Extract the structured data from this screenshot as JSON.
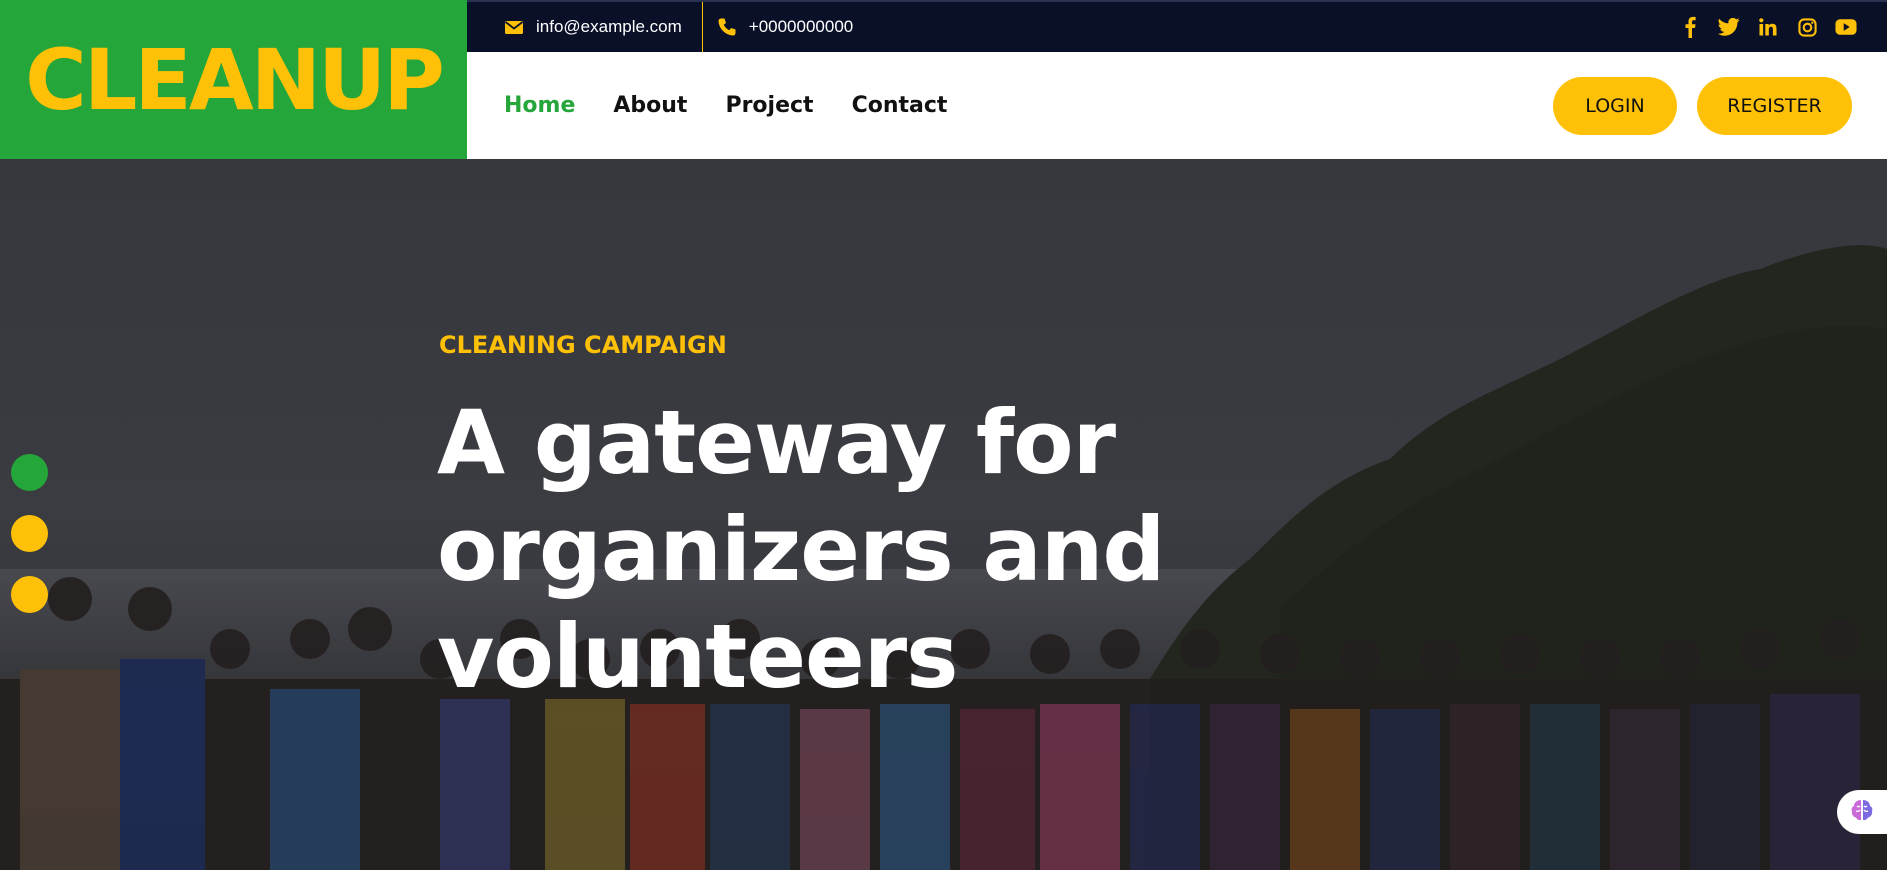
{
  "brand": {
    "logo_text": "CLEANUP",
    "green": "#25a63a",
    "yellow": "#ffc107",
    "navy": "#0b1029"
  },
  "topbar": {
    "email": {
      "icon": "envelope-icon",
      "text": "info@example.com"
    },
    "phone": {
      "icon": "phone-icon",
      "text": "+0000000000"
    },
    "social": [
      "facebook-icon",
      "twitter-icon",
      "linkedin-icon",
      "instagram-icon",
      "youtube-icon"
    ]
  },
  "nav": {
    "links": [
      {
        "label": "Home",
        "active": true
      },
      {
        "label": "About"
      },
      {
        "label": "Project"
      },
      {
        "label": "Contact"
      }
    ],
    "login_label": "LOGIN",
    "register_label": "REGISTER"
  },
  "hero": {
    "subtitle": "CLEANING CAMPAIGN",
    "title_line1": "A gateway for",
    "title_line2": "organizers and",
    "title_line3": "volunteers",
    "slide_count": 3,
    "active_slide": 1
  },
  "widget": {
    "icon": "brain-icon"
  }
}
